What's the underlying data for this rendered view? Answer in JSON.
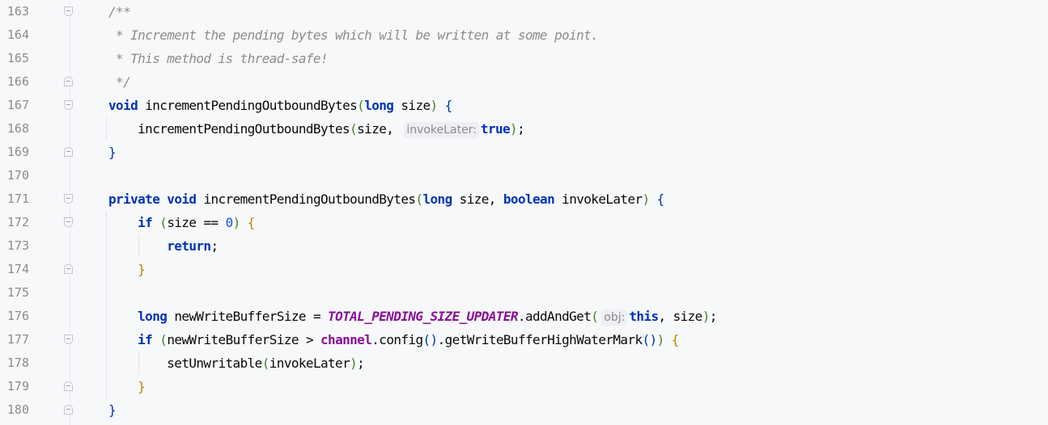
{
  "editor": {
    "lines": [
      {
        "number": "163",
        "fold": "open"
      },
      {
        "number": "164",
        "fold": ""
      },
      {
        "number": "165",
        "fold": ""
      },
      {
        "number": "166",
        "fold": "close"
      },
      {
        "number": "167",
        "fold": "open"
      },
      {
        "number": "168",
        "fold": ""
      },
      {
        "number": "169",
        "fold": "close"
      },
      {
        "number": "170",
        "fold": ""
      },
      {
        "number": "171",
        "fold": "open"
      },
      {
        "number": "172",
        "fold": "open"
      },
      {
        "number": "173",
        "fold": ""
      },
      {
        "number": "174",
        "fold": "close"
      },
      {
        "number": "175",
        "fold": ""
      },
      {
        "number": "176",
        "fold": ""
      },
      {
        "number": "177",
        "fold": "open"
      },
      {
        "number": "178",
        "fold": ""
      },
      {
        "number": "179",
        "fold": "close"
      },
      {
        "number": "180",
        "fold": "close"
      }
    ],
    "code": {
      "l163": "/**",
      "l164": " * Increment the pending bytes which will be written at some point.",
      "l165": " * This method is thread-safe!",
      "l166": " */",
      "kw_void": "void",
      "kw_long": "long",
      "kw_private": "private",
      "kw_boolean": "boolean",
      "kw_if": "if",
      "kw_return": "return",
      "kw_true": "true",
      "kw_this": "this",
      "method_name": "incrementPendingOutboundBytes",
      "param_size": "size",
      "param_invokeLater": "invokeLater",
      "hint_invokeLater": "invokeLater:",
      "hint_obj": "obj:",
      "zero": "0",
      "var_new": "newWriteBufferSize",
      "static_updater": "TOTAL_PENDING_SIZE_UPDATER",
      "add_and_get": "addAndGet",
      "field_channel": "channel",
      "config": "config",
      "get_high": "getWriteBufferHighWaterMark",
      "set_unwritable": "setUnwritable"
    }
  },
  "colors": {
    "background": "#f7f8fa",
    "keyword": "#0033b3",
    "comment": "#8c8c8c",
    "static_field": "#871094",
    "number": "#1750eb",
    "line_number": "#8c8c8c"
  }
}
